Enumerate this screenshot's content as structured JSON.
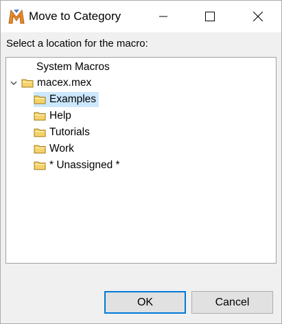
{
  "window": {
    "title": "Move to Category",
    "icon": "macro-express-logo-icon"
  },
  "prompt": "Select a location for the macro:",
  "tree": {
    "root": "System Macros",
    "file": {
      "label": "macex.mex",
      "expanded": true
    },
    "categories": [
      {
        "label": "Examples",
        "selected": true
      },
      {
        "label": "Help",
        "selected": false
      },
      {
        "label": "Tutorials",
        "selected": false
      },
      {
        "label": "Work",
        "selected": false
      },
      {
        "label": "* Unassigned *",
        "selected": false
      }
    ]
  },
  "buttons": {
    "ok": "OK",
    "cancel": "Cancel"
  },
  "colors": {
    "selection": "#cce8ff",
    "folder": "#f5d36b",
    "default_button_border": "#0078d7"
  }
}
